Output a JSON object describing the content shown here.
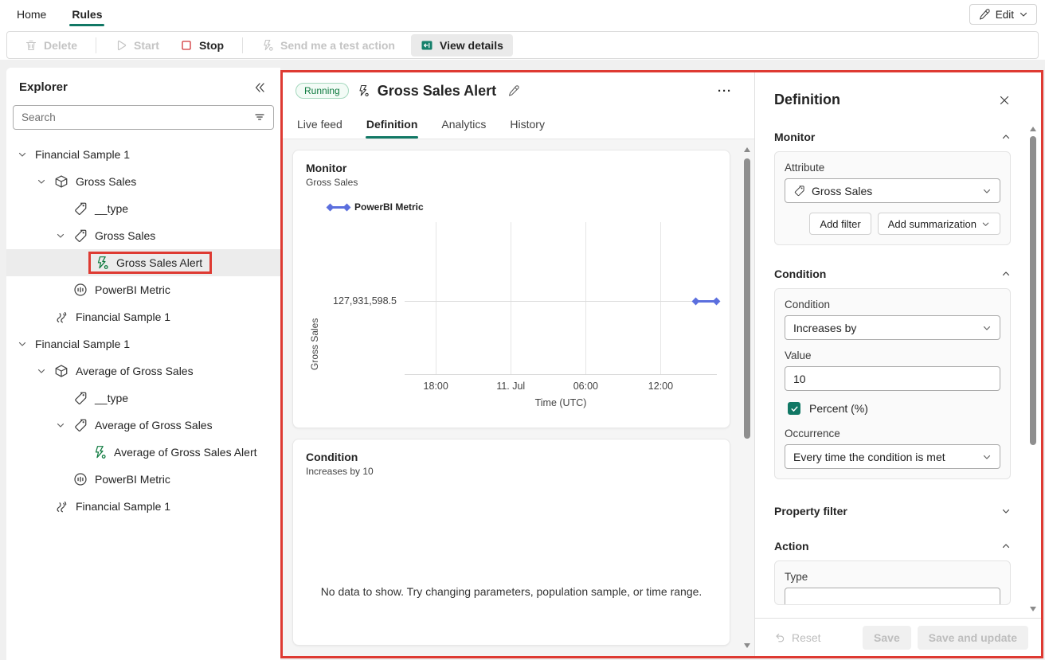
{
  "topbar": {
    "tabs": [
      "Home",
      "Rules"
    ],
    "active_tab": "Rules",
    "edit_label": "Edit"
  },
  "toolbar": {
    "delete_label": "Delete",
    "start_label": "Start",
    "stop_label": "Stop",
    "send_test_label": "Send me a test action",
    "view_details_label": "View details"
  },
  "explorer": {
    "title": "Explorer",
    "search_placeholder": "Search",
    "tree": [
      {
        "label": "Financial Sample 1"
      },
      {
        "label": "Gross Sales"
      },
      {
        "label": "__type"
      },
      {
        "label": "Gross Sales"
      },
      {
        "label": "Gross Sales Alert"
      },
      {
        "label": "PowerBI Metric"
      },
      {
        "label": "Financial Sample 1"
      },
      {
        "label": "Financial Sample 1"
      },
      {
        "label": "Average of Gross Sales"
      },
      {
        "label": "__type"
      },
      {
        "label": "Average of Gross Sales"
      },
      {
        "label": "Average of Gross Sales Alert"
      },
      {
        "label": "PowerBI Metric"
      },
      {
        "label": "Financial Sample 1"
      }
    ]
  },
  "main": {
    "status_badge": "Running",
    "title": "Gross Sales Alert",
    "tabs": [
      "Live feed",
      "Definition",
      "Analytics",
      "History"
    ],
    "active_tab": "Definition",
    "more_label": "···",
    "monitor_card": {
      "title": "Monitor",
      "subtitle": "Gross Sales"
    },
    "condition_card": {
      "title": "Condition",
      "subtitle": "Increases by 10",
      "empty_message": "No data to show. Try changing parameters, population sample, or time range."
    }
  },
  "chart_data": {
    "type": "line",
    "title": "Monitor",
    "subtitle": "Gross Sales",
    "xlabel": "Time (UTC)",
    "ylabel": "Gross Sales",
    "x_ticks": [
      "18:00",
      "11. Jul",
      "06:00",
      "12:00"
    ],
    "y_ticks": [
      "127,931,598.5"
    ],
    "grid": true,
    "legend_position": "top-left",
    "legend": [
      {
        "name": "PowerBI Metric",
        "color": "#5B6FDE",
        "marker": "diamond-line"
      }
    ],
    "series": [
      {
        "name": "PowerBI Metric",
        "points": [
          {
            "x": "shortly after 12:00 tick (~93% of x-range)",
            "y": 127931598.5
          },
          {
            "x": "right edge of plotted range (~100%)",
            "y": 127931598.5
          }
        ]
      }
    ]
  },
  "panel": {
    "title": "Definition",
    "monitor": {
      "title": "Monitor",
      "attribute_label": "Attribute",
      "attribute_value": "Gross Sales",
      "add_filter_label": "Add filter",
      "add_summarization_label": "Add summarization"
    },
    "condition": {
      "title": "Condition",
      "condition_label": "Condition",
      "condition_value": "Increases by",
      "value_label": "Value",
      "value": "10",
      "percent_label": "Percent (%)",
      "percent_checked": true,
      "occurrence_label": "Occurrence",
      "occurrence_value": "Every time the condition is met"
    },
    "property_filter": {
      "title": "Property filter"
    },
    "action": {
      "title": "Action",
      "type_label": "Type"
    },
    "footer": {
      "reset_label": "Reset",
      "save_label": "Save",
      "save_update_label": "Save and update"
    }
  },
  "colors": {
    "accent_teal": "#117865",
    "annotation_red": "#DE3A32",
    "chart_blue": "#5B6FDE",
    "running_green": "#0E7A3F",
    "disabled_gray": "#BDBDBD"
  }
}
